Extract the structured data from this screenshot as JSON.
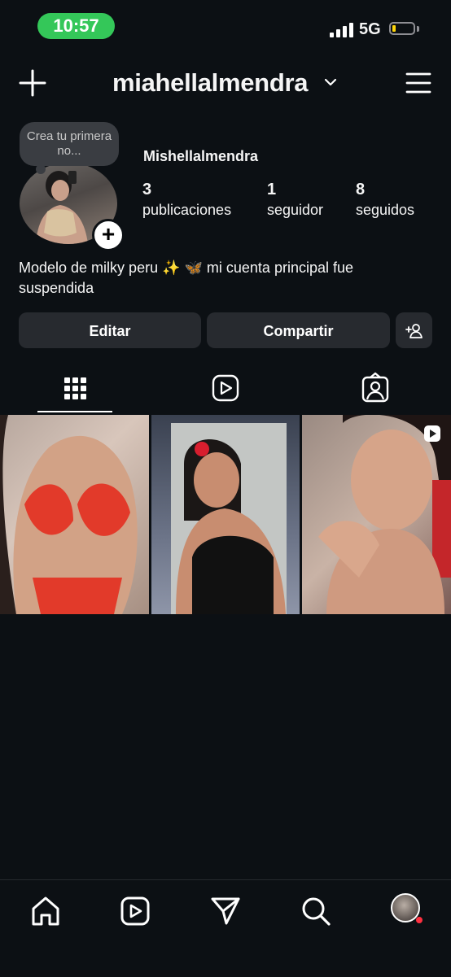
{
  "status_bar": {
    "time": "10:57",
    "network": "5G",
    "accent_time_bg": "#34c759",
    "battery_color": "#ffd60a"
  },
  "header": {
    "username": "miahellalmendra",
    "icons": {
      "create": "plus-icon",
      "switch_account": "chevron-down-icon",
      "menu": "hamburger-menu-icon"
    }
  },
  "profile": {
    "note_text": "Crea tu primera no...",
    "display_name": "Mishellalmendra",
    "stats": [
      {
        "value": "3",
        "label": "publicaciones"
      },
      {
        "value": "1",
        "label": "seguidor"
      },
      {
        "value": "8",
        "label": "seguidos"
      }
    ],
    "bio": "Modelo de milky peru ✨ 🦋  mi cuenta principal fue suspendida"
  },
  "actions": {
    "edit_label": "Editar",
    "share_label": "Compartir",
    "discover_people_icon": "add-person-icon"
  },
  "tabs": [
    {
      "icon": "grid-icon",
      "active": true
    },
    {
      "icon": "reels-icon",
      "active": false
    },
    {
      "icon": "tagged-icon",
      "active": false
    }
  ],
  "posts": [
    {
      "type": "photo"
    },
    {
      "type": "photo"
    },
    {
      "type": "reel"
    }
  ],
  "bottom_nav": [
    {
      "icon": "home-icon"
    },
    {
      "icon": "reels-icon"
    },
    {
      "icon": "direct-send-icon"
    },
    {
      "icon": "search-icon"
    },
    {
      "icon": "profile-avatar"
    }
  ]
}
